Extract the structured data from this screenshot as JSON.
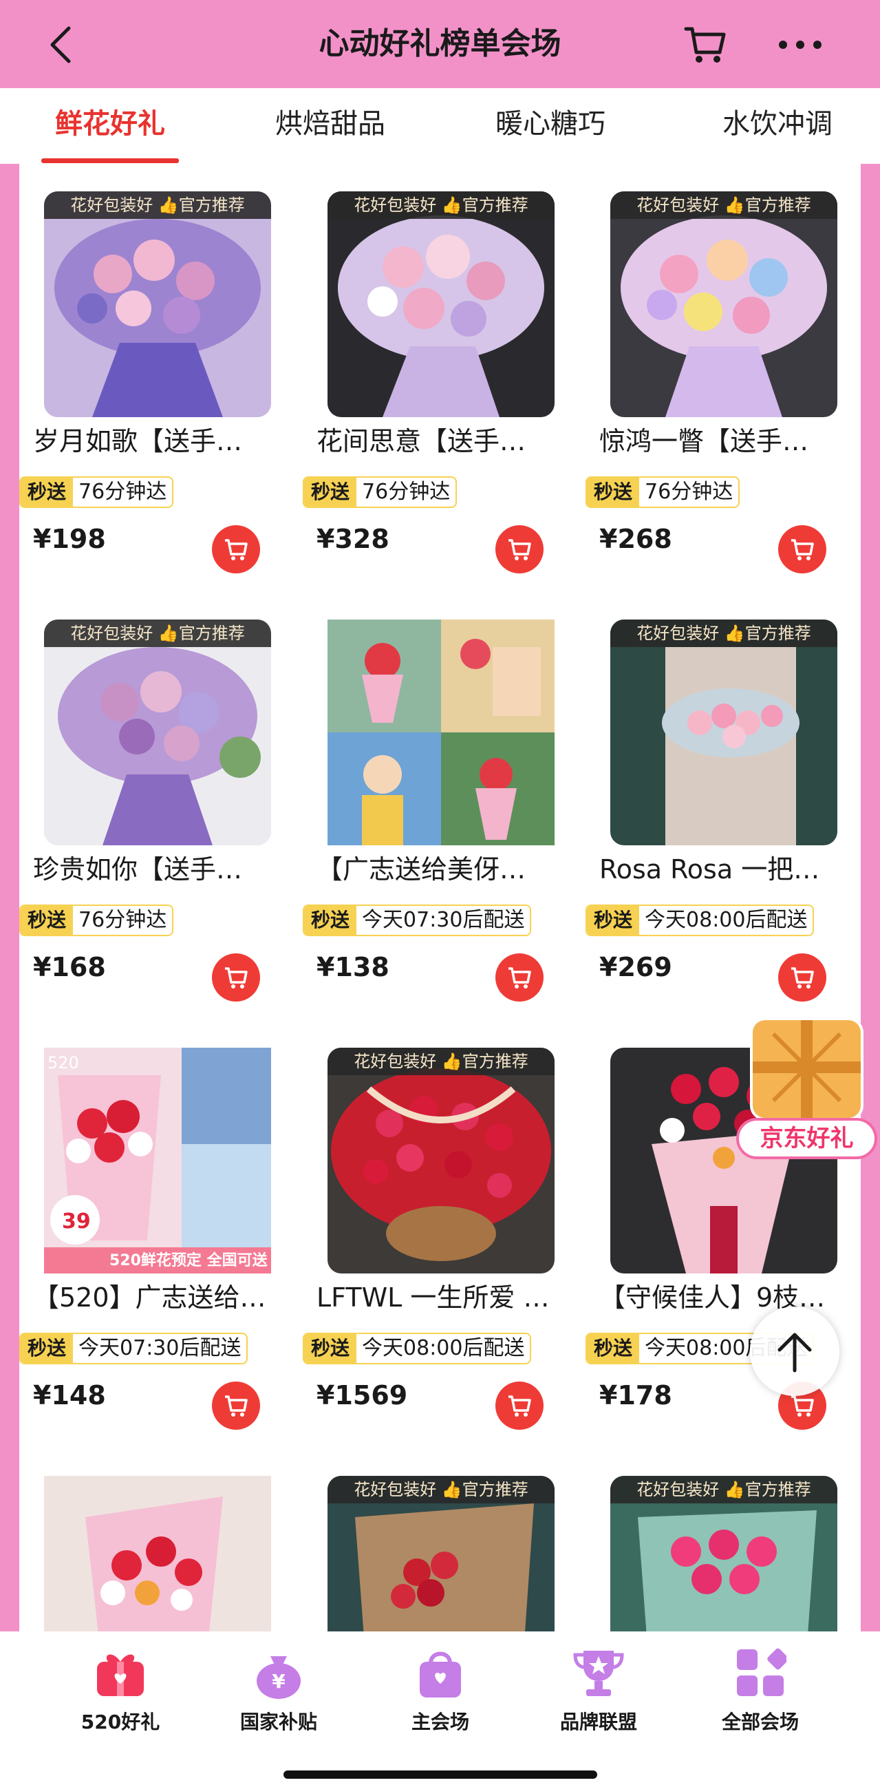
{
  "header": {
    "title": "心动好礼榜单会场",
    "back_icon": "back-chevron-icon",
    "cart_icon": "cart-icon",
    "more_icon": "more-dots-icon"
  },
  "tabs": [
    {
      "label": "鲜花好礼",
      "active": true
    },
    {
      "label": "烘焙甜品",
      "active": false
    },
    {
      "label": "暖心糖巧",
      "active": false
    },
    {
      "label": "水饮冲调",
      "active": false
    }
  ],
  "theme": {
    "accent": "#e8332f",
    "pink": "#f291c8",
    "delivery_tag": "#f7d252",
    "cart_button": "#ef3b36"
  },
  "products": [
    {
      "title": "岁月如歌【送手…",
      "banner": "花好包装好 👍官方推荐",
      "delivery_tag": "秒送",
      "delivery_text": "76分钟达",
      "price": "¥198"
    },
    {
      "title": "花间思意【送手…",
      "banner": "花好包装好 👍官方推荐",
      "delivery_tag": "秒送",
      "delivery_text": "76分钟达",
      "price": "¥328"
    },
    {
      "title": "惊鸿一瞥【送手…",
      "banner": "花好包装好 👍官方推荐",
      "delivery_tag": "秒送",
      "delivery_text": "76分钟达",
      "price": "¥268"
    },
    {
      "title": "珍贵如你【送手…",
      "banner": "花好包装好 👍官方推荐",
      "delivery_tag": "秒送",
      "delivery_text": "76分钟达",
      "price": "¥168"
    },
    {
      "title": "【广志送给美伢…",
      "banner": "",
      "delivery_tag": "秒送",
      "delivery_text": "今天07:30后配送",
      "price": "¥138"
    },
    {
      "title": "Rosa Rosa 一把…",
      "banner": "花好包装好 👍官方推荐",
      "delivery_tag": "秒送",
      "delivery_text": "今天08:00后配送",
      "price": "¥269"
    },
    {
      "title": "【520】广志送给…",
      "banner": "",
      "delivery_tag": "秒送",
      "delivery_text": "今天07:30后配送",
      "price": "¥148"
    },
    {
      "title": "LFTWL 一生所爱 …",
      "banner": "花好包装好 👍官方推荐",
      "delivery_tag": "秒送",
      "delivery_text": "今天08:00后配送",
      "price": "¥1569"
    },
    {
      "title": "【守候佳人】9枝…",
      "banner": "",
      "delivery_tag": "秒送",
      "delivery_text": "今天08:00后配送",
      "price": "¥178"
    },
    {
      "title": "",
      "banner": "",
      "delivery_tag": "",
      "delivery_text": "",
      "price": ""
    },
    {
      "title": "",
      "banner": "花好包装好 👍官方推荐",
      "delivery_tag": "",
      "delivery_text": "",
      "price": ""
    },
    {
      "title": "",
      "banner": "花好包装好 👍官方推荐",
      "delivery_tag": "",
      "delivery_text": "",
      "price": ""
    }
  ],
  "image_overlays": {
    "badge_520": "520",
    "price_badge": "39",
    "promo_line": "520鲜花预定 全国可送"
  },
  "floating": {
    "gift_label": "京东好礼",
    "gift_icon": "gift-box-icon",
    "top_icon": "arrow-up-icon"
  },
  "bottom_nav": [
    {
      "label": "520好礼",
      "icon": "gift-icon"
    },
    {
      "label": "国家补贴",
      "icon": "money-bag-icon"
    },
    {
      "label": "主会场",
      "icon": "shopping-bag-icon"
    },
    {
      "label": "品牌联盟",
      "icon": "trophy-icon"
    },
    {
      "label": "全部会场",
      "icon": "grid-apps-icon"
    }
  ]
}
